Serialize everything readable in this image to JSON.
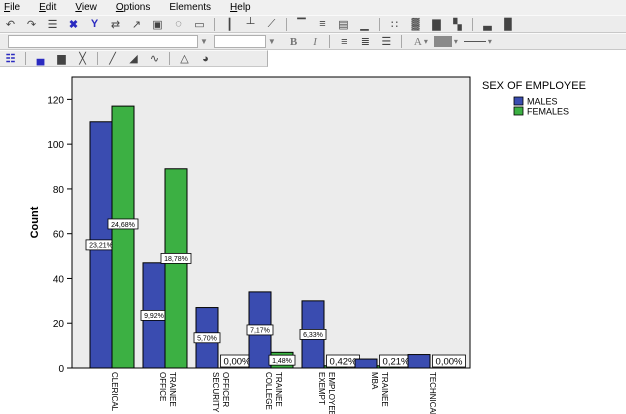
{
  "menu": {
    "items": [
      {
        "label": "File",
        "key": "F",
        "rest": "ile"
      },
      {
        "label": "Edit",
        "key": "E",
        "rest": "dit"
      },
      {
        "label": "View",
        "key": "V",
        "rest": "iew"
      },
      {
        "label": "Options",
        "key": "O",
        "rest": "ptions"
      },
      {
        "label": "Elements",
        "key": "",
        "rest": "Elements"
      },
      {
        "label": "Help",
        "key": "H",
        "rest": "elp"
      }
    ]
  },
  "toolbar2": {
    "font_value": "",
    "size_value": "",
    "bold_label": "B",
    "italic_label": "I",
    "text_color_label": "A"
  },
  "colors": {
    "males": "#3a4cb0",
    "females": "#3cb043",
    "plot_bg": "#ececec",
    "toolbar_bg": "#ececec"
  },
  "chart_data": {
    "type": "bar",
    "title": "",
    "xlabel": "",
    "ylabel": "Count",
    "ylim": [
      0,
      130
    ],
    "yticks": [
      0,
      20,
      40,
      60,
      80,
      100,
      120
    ],
    "grid": false,
    "legend_title": "SEX OF EMPLOYEE",
    "legend_position": "right",
    "categories": [
      "CLERICAL",
      "OFFICE TRAINEE",
      "SECURITY OFFICER",
      "COLLEGE TRAINEE",
      "EXEMPT EMPLOYEE",
      "MBA TRAINEE",
      "TECHNICAL"
    ],
    "series": [
      {
        "name": "MALES",
        "values": [
          110,
          47,
          27,
          34,
          30,
          4,
          6
        ],
        "labels": [
          "23,21%",
          "9,92%",
          "5,70%",
          "7,17%",
          "6,33%",
          "",
          ""
        ]
      },
      {
        "name": "FEMALES",
        "values": [
          117,
          89,
          0,
          7,
          1,
          1,
          0
        ],
        "labels": [
          "24,68%",
          "18,78%",
          "0,00%",
          "1,48%",
          "0,42%",
          "0,21%",
          "0,00%"
        ]
      }
    ]
  }
}
